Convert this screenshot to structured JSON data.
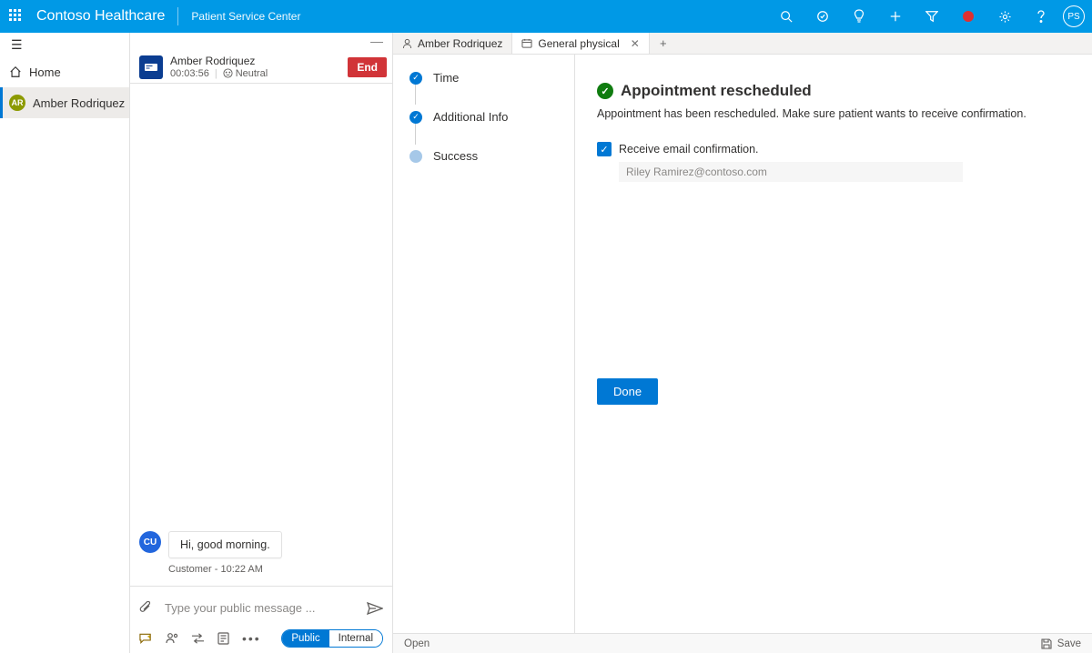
{
  "topbar": {
    "brand": "Contoso Healthcare",
    "subtitle": "Patient Service Center",
    "avatar_initials": "PS"
  },
  "sidebar": {
    "home_label": "Home",
    "items": [
      {
        "initials": "AR",
        "label": "Amber Rodriquez"
      }
    ]
  },
  "conversation": {
    "name": "Amber Rodriquez",
    "timer": "00:03:56",
    "sentiment": "Neutral",
    "end_label": "End",
    "messages": [
      {
        "avatar": "CU",
        "text": "Hi, good morning."
      }
    ],
    "message_meta": "Customer - 10:22 AM",
    "compose_placeholder": "Type your public message ...",
    "mode_public": "Public",
    "mode_internal": "Internal"
  },
  "stepper": {
    "steps": [
      {
        "label": "Time",
        "state": "done"
      },
      {
        "label": "Additional Info",
        "state": "done"
      },
      {
        "label": "Success",
        "state": "current"
      }
    ]
  },
  "tabs": [
    {
      "label": "Amber Rodriquez",
      "active": false
    },
    {
      "label": "General physical",
      "active": true
    }
  ],
  "detail": {
    "title": "Appointment rescheduled",
    "description": "Appointment has been rescheduled. Make sure patient wants to receive confirmation.",
    "checkbox_label": "Receive email confirmation.",
    "email_value": "Riley Ramirez@contoso.com",
    "done_label": "Done"
  },
  "statusbar": {
    "open_label": "Open",
    "save_label": "Save"
  }
}
